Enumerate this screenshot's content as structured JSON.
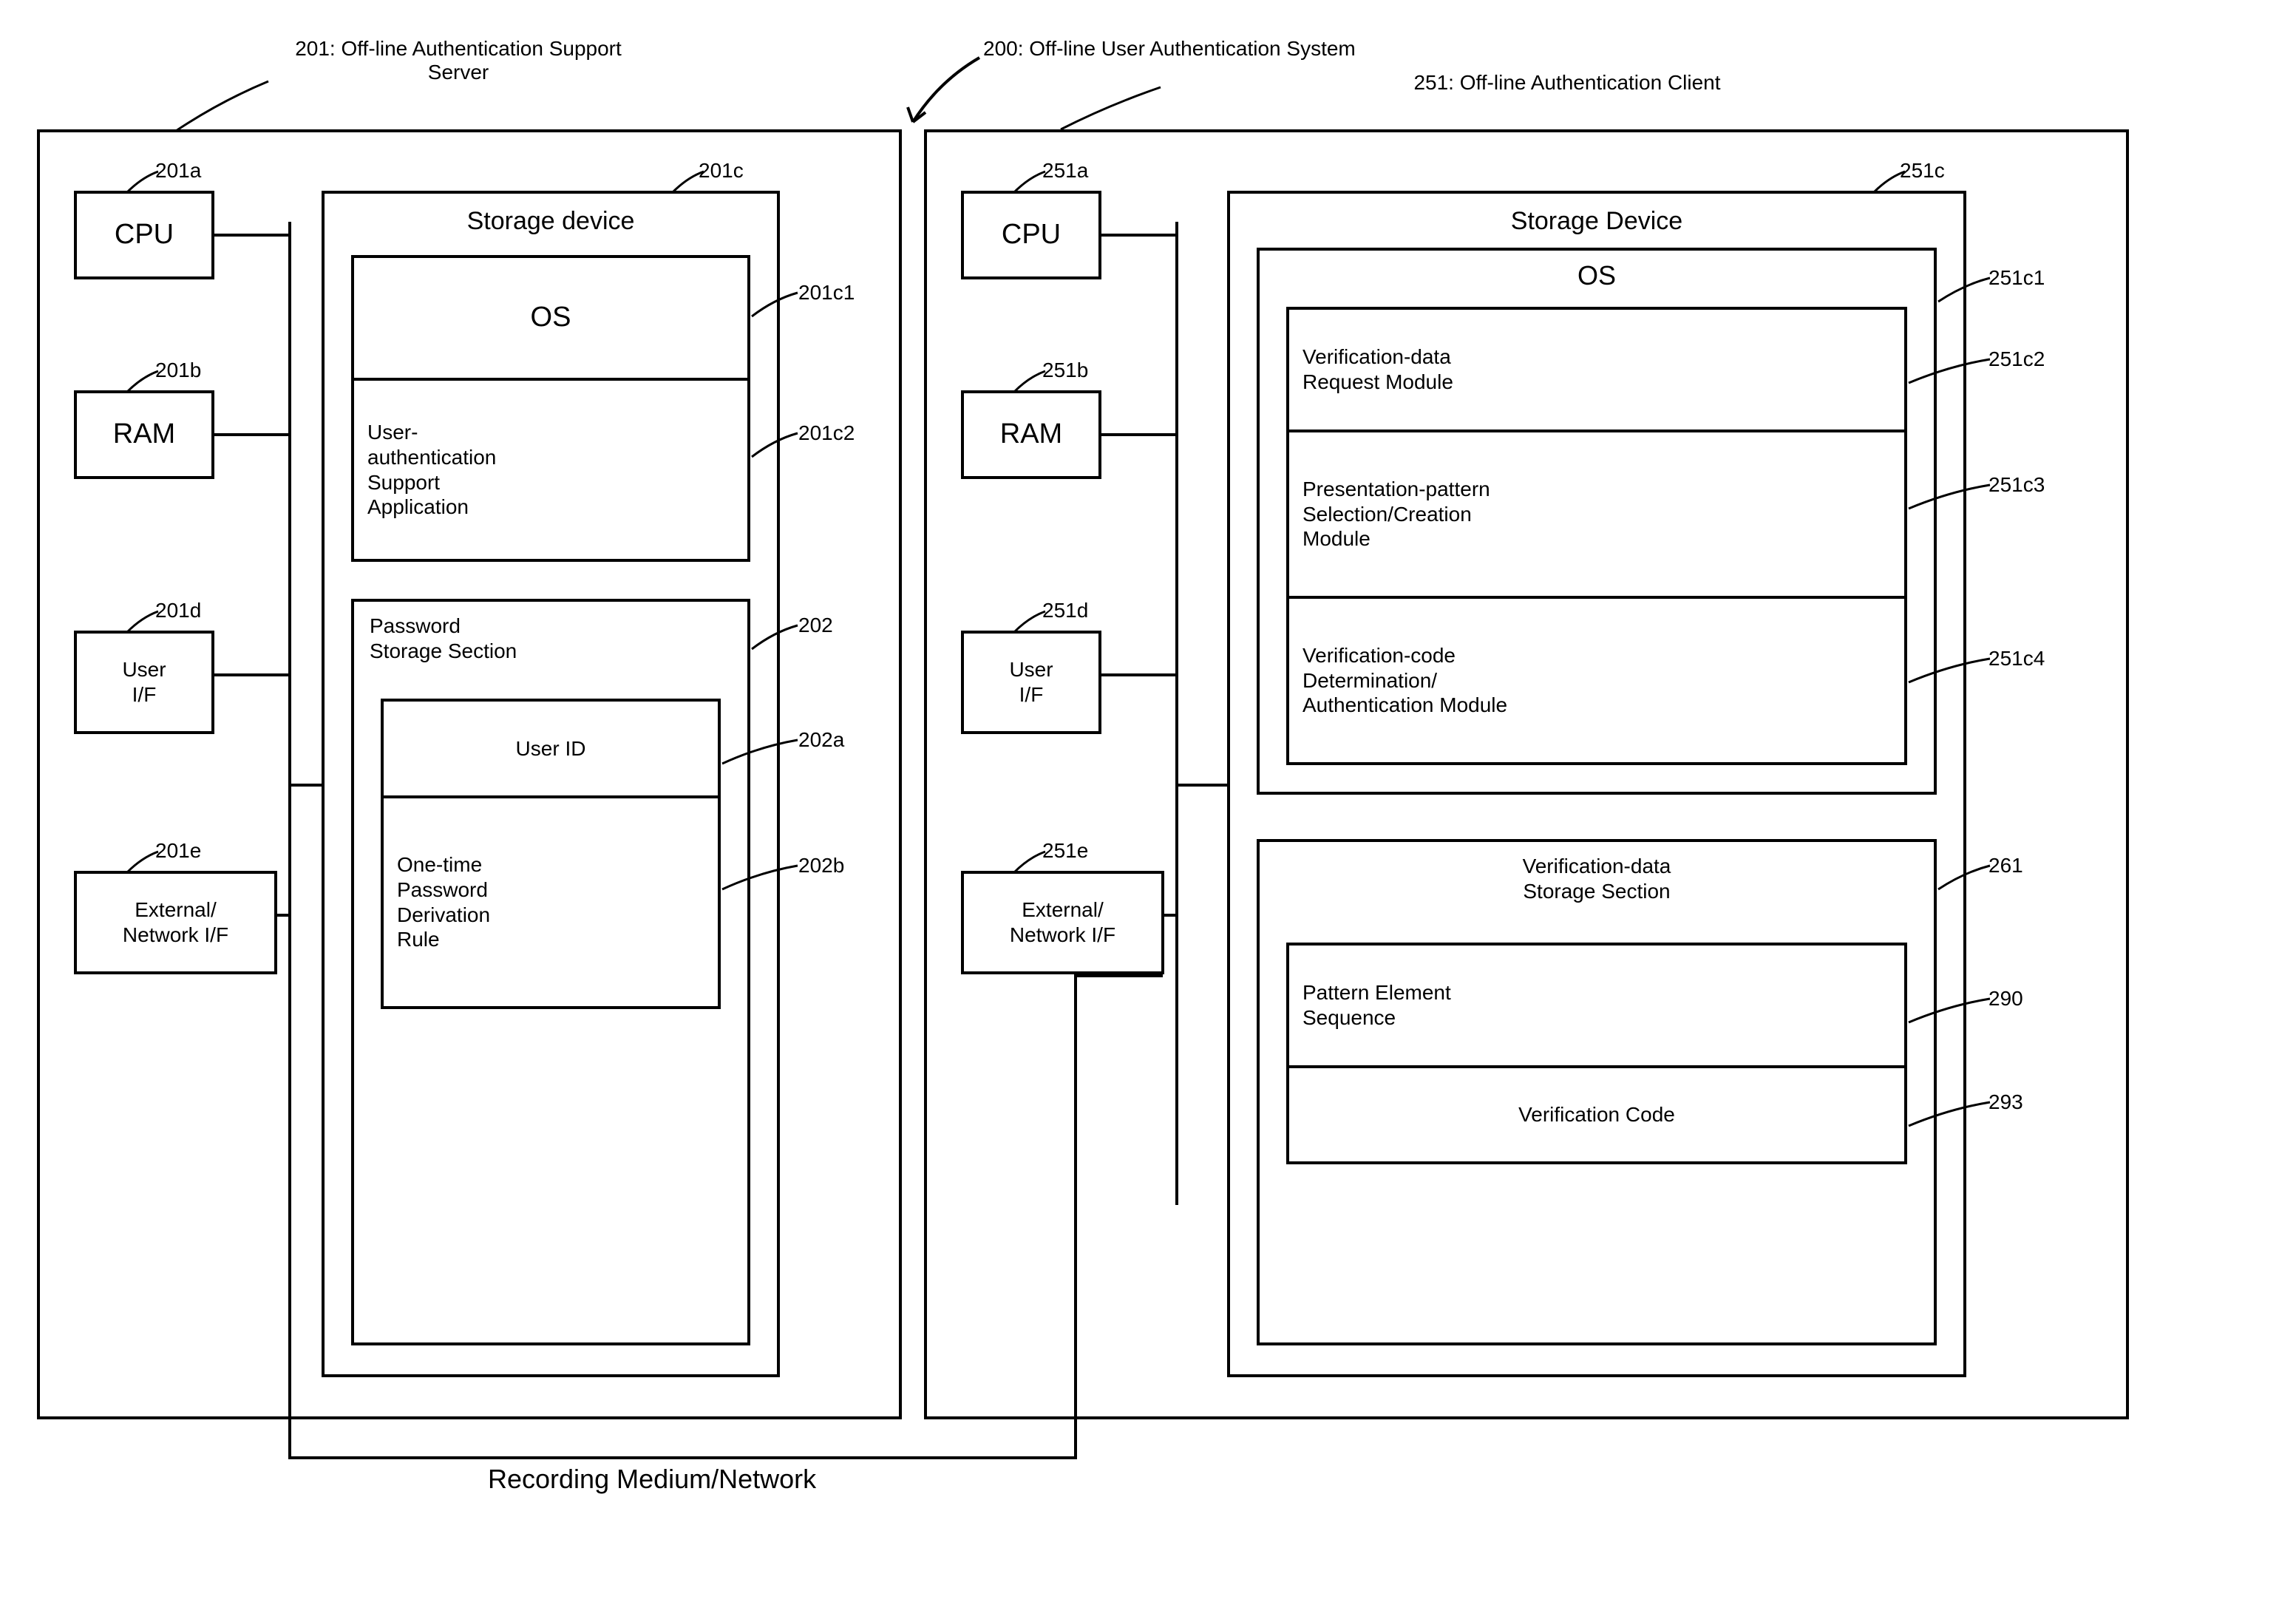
{
  "title_200": "200: Off-line User Authentication System",
  "server": {
    "title": "201: Off-line Authentication Support Server",
    "cpu": {
      "ref": "201a",
      "label": "CPU"
    },
    "ram": {
      "ref": "201b",
      "label": "RAM"
    },
    "userif": {
      "ref": "201d",
      "label": "User I/F"
    },
    "extif": {
      "ref": "201e",
      "label": "External/ Network I/F"
    },
    "storage": {
      "ref": "201c",
      "label": "Storage device"
    },
    "os": {
      "ref": "201c1",
      "label": "OS"
    },
    "uasa": {
      "ref": "201c2",
      "label": "User- authentication Support Application"
    },
    "pss": {
      "ref": "202",
      "label": "Password Storage Section"
    },
    "userid": {
      "ref": "202a",
      "label": "User ID"
    },
    "otp": {
      "ref": "202b",
      "label": "One-time Password Derivation Rule"
    }
  },
  "client": {
    "title": "251: Off-line Authentication Client",
    "cpu": {
      "ref": "251a",
      "label": "CPU"
    },
    "ram": {
      "ref": "251b",
      "label": "RAM"
    },
    "userif": {
      "ref": "251d",
      "label": "User I/F"
    },
    "extif": {
      "ref": "251e",
      "label": "External/ Network I/F"
    },
    "storage": {
      "ref": "251c",
      "label": "Storage Device"
    },
    "os": {
      "ref": "251c1",
      "label": "OS"
    },
    "vdreq": {
      "ref": "251c2",
      "label": "Verification-data Request Module"
    },
    "pps": {
      "ref": "251c3",
      "label": "Presentation-pattern Selection/Creation Module"
    },
    "vcda": {
      "ref": "251c4",
      "label": "Verification-code Determination/ Authentication Module"
    },
    "vdss": {
      "ref": "261",
      "label": "Verification-data Storage Section"
    },
    "pes": {
      "ref": "290",
      "label": "Pattern Element Sequence"
    },
    "vcode": {
      "ref": "293",
      "label": "Verification Code"
    }
  },
  "bottom": "Recording Medium/Network"
}
